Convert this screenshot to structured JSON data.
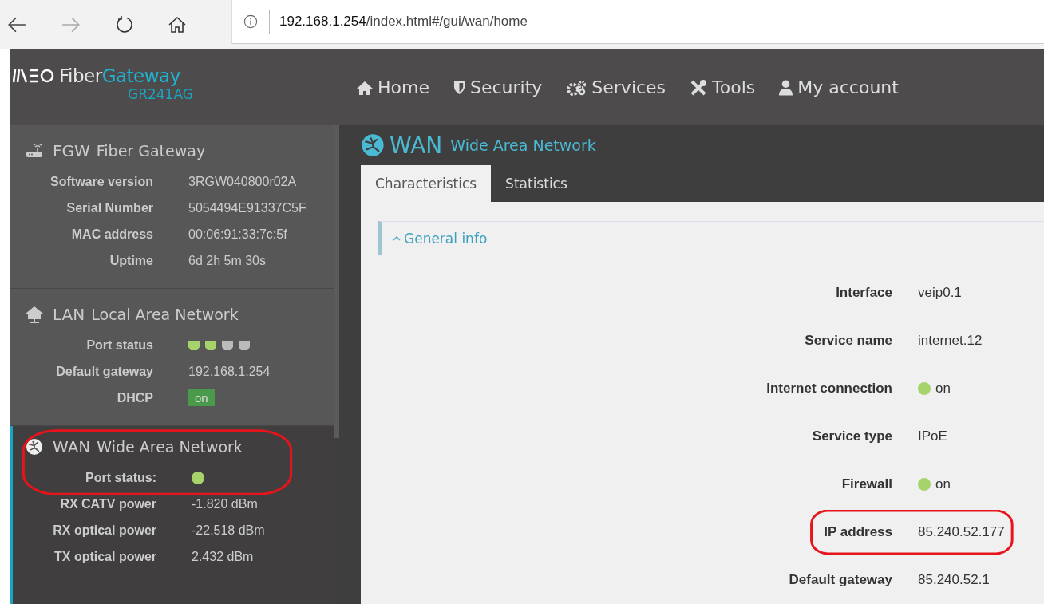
{
  "browser": {
    "url_host": "192.168.1.254",
    "url_path": "/index.html#/gui/wan/home"
  },
  "brand": {
    "name_part1": "Fiber",
    "name_part2": "Gateway",
    "model": "GR241AG"
  },
  "nav": [
    {
      "kind": "home",
      "label": "Home"
    },
    {
      "kind": "security",
      "label": "Security"
    },
    {
      "kind": "services",
      "label": "Services"
    },
    {
      "kind": "tools",
      "label": "Tools"
    },
    {
      "kind": "account",
      "label": "My account"
    }
  ],
  "sidebar": [
    {
      "kind": "router",
      "abbr": "FGW",
      "title": "Fiber Gateway",
      "selected": false,
      "highlighted": false,
      "rows": [
        {
          "kind": "text",
          "label": "Software version",
          "value": "3RGW040800r02A"
        },
        {
          "kind": "text",
          "label": "Serial Number",
          "value": "5054494E91337C5F"
        },
        {
          "kind": "text",
          "label": "MAC address",
          "value": "00:06:91:33:7c:5f"
        },
        {
          "kind": "text",
          "label": "Uptime",
          "value": "6d 2h 5m 30s"
        }
      ]
    },
    {
      "kind": "house",
      "abbr": "LAN",
      "title": "Local Area Network",
      "selected": false,
      "highlighted": false,
      "rows": [
        {
          "kind": "ports",
          "label": "Port status",
          "ports": [
            {
              "on": true
            },
            {
              "on": true
            },
            {
              "on": false
            },
            {
              "on": false
            }
          ]
        },
        {
          "kind": "text",
          "label": "Default gateway",
          "value": "192.168.1.254"
        },
        {
          "kind": "badge",
          "label": "DHCP",
          "value": "on",
          "on": true
        }
      ]
    },
    {
      "kind": "globe",
      "abbr": "WAN",
      "title": "Wide Area Network",
      "selected": true,
      "highlighted": true,
      "rows": [
        {
          "kind": "dot",
          "label": "Port status:",
          "on": true
        },
        {
          "kind": "text",
          "label": "RX CATV power",
          "value": "-1.820 dBm"
        },
        {
          "kind": "text",
          "label": "RX optical power",
          "value": "-22.518 dBm"
        },
        {
          "kind": "text",
          "label": "TX optical power",
          "value": "2.432 dBm"
        }
      ]
    }
  ],
  "page": {
    "abbr": "WAN",
    "title": "Wide Area Network",
    "tabs": [
      {
        "label": "Characteristics",
        "selected": true
      },
      {
        "label": "Statistics",
        "selected": false
      }
    ],
    "section": {
      "label": "General info",
      "expanded": true
    },
    "fields": [
      {
        "kind": "text",
        "label": "Interface",
        "value": "veip0.1",
        "highlighted": false
      },
      {
        "kind": "text",
        "label": "Service name",
        "value": "internet.12",
        "highlighted": false
      },
      {
        "kind": "status",
        "label": "Internet connection",
        "value": "on",
        "on": true,
        "highlighted": false
      },
      {
        "kind": "text",
        "label": "Service type",
        "value": "IPoE",
        "highlighted": false
      },
      {
        "kind": "status",
        "label": "Firewall",
        "value": "on",
        "on": true,
        "highlighted": false
      },
      {
        "kind": "text",
        "label": "IP address",
        "value": "85.240.52.177",
        "highlighted": true
      },
      {
        "kind": "text",
        "label": "Default gateway",
        "value": "85.240.52.1",
        "highlighted": false
      }
    ]
  }
}
